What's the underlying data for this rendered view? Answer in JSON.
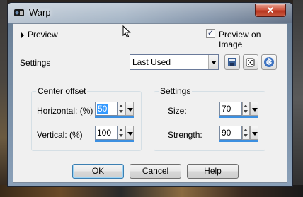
{
  "window": {
    "title": "Warp",
    "close_glyph": "✕"
  },
  "preview": {
    "label": "Preview",
    "preview_on_image_label": "Preview on Image",
    "preview_on_image_checked": true
  },
  "settings_row": {
    "label": "Settings",
    "preset_value": "Last Used",
    "tool_icons": [
      "save-preset-icon",
      "randomize-dice-icon",
      "reset-arrow-icon"
    ]
  },
  "center_offset": {
    "title": "Center offset",
    "horizontal_label": "Horizontal: (%)",
    "horizontal_value": "50",
    "vertical_label": "Vertical: (%)",
    "vertical_value": "100"
  },
  "settings_group": {
    "title": "Settings",
    "size_label": "Size:",
    "size_value": "70",
    "strength_label": "Strength:",
    "strength_value": "90"
  },
  "buttons": {
    "ok": "OK",
    "cancel": "Cancel",
    "help": "Help"
  },
  "colors": {
    "close_red": "#c8452e",
    "selection_blue": "#3399ff",
    "spin_bar_blue": "#3c8fe0"
  }
}
